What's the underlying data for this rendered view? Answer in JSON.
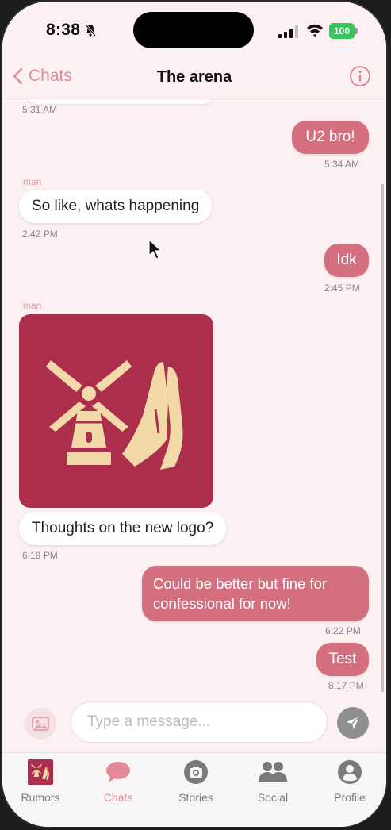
{
  "status_bar": {
    "time": "8:38",
    "battery": "100"
  },
  "nav": {
    "back_label": "Chats",
    "title": "The arena"
  },
  "messages": {
    "m0_time": "5:31 AM",
    "m1_text": "U2 bro!",
    "m1_time": "5:34 AM",
    "m2_sender": "man",
    "m2_text": "So like, whats happening",
    "m2_time": "2:42 PM",
    "m3_text": "Idk",
    "m3_time": "2:45 PM",
    "m4_sender": "man",
    "m4_text": "Thoughts on the new logo?",
    "m4_time": "6:18 PM",
    "m5_text": "Could be better but fine for confessional for now!",
    "m5_time": "6:22 PM",
    "m6_text": "Test",
    "m6_time": "8:17 PM"
  },
  "composer": {
    "placeholder": "Type a message..."
  },
  "tabs": [
    {
      "label": "Rumors",
      "icon": "rumors-logo-icon"
    },
    {
      "label": "Chats",
      "icon": "chat-bubble-icon"
    },
    {
      "label": "Stories",
      "icon": "camera-icon"
    },
    {
      "label": "Social",
      "icon": "people-icon"
    },
    {
      "label": "Profile",
      "icon": "person-icon"
    }
  ],
  "colors": {
    "accent": "#e58a98",
    "outgoing_bubble": "#d46f80",
    "logo_background": "#ab2f4d",
    "logo_foreground": "#f3d9a8"
  }
}
